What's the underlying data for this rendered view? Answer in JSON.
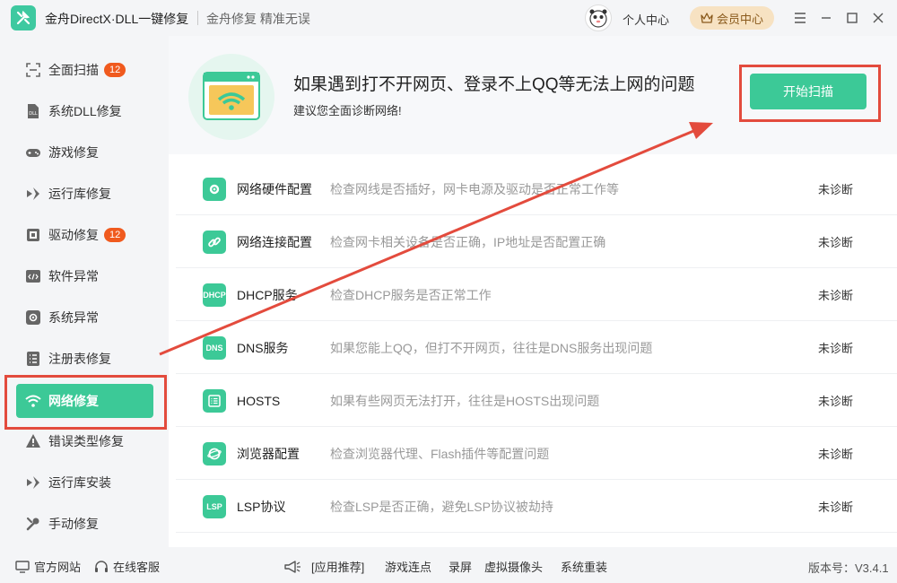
{
  "app": {
    "title": "金舟DirectX·DLL一键修复",
    "slogan": "金舟修复 精准无误",
    "personal_center": "个人中心",
    "vip_center": "会员中心"
  },
  "sidebar": {
    "items": [
      {
        "label": "全面扫描",
        "icon": "scan-icon",
        "badge": "12"
      },
      {
        "label": "系统DLL修复",
        "icon": "dll-icon"
      },
      {
        "label": "游戏修复",
        "icon": "gamepad-icon"
      },
      {
        "label": "运行库修复",
        "icon": "runtime-icon"
      },
      {
        "label": "驱动修复",
        "icon": "driver-icon",
        "badge": "12"
      },
      {
        "label": "软件异常",
        "icon": "code-icon"
      },
      {
        "label": "系统异常",
        "icon": "gear-icon"
      },
      {
        "label": "注册表修复",
        "icon": "registry-icon"
      },
      {
        "label": "网络修复",
        "icon": "wifi-icon",
        "active": true
      },
      {
        "label": "错误类型修复",
        "icon": "warning-icon"
      },
      {
        "label": "运行库安装",
        "icon": "runtime-install-icon"
      },
      {
        "label": "手动修复",
        "icon": "wrench-icon"
      }
    ]
  },
  "hero": {
    "title": "如果遇到打不开网页、登录不上QQ等无法上网的问题",
    "subtitle": "建议您全面诊断网络!",
    "scan_button": "开始扫描"
  },
  "checks": [
    {
      "name": "网络硬件配置",
      "desc": "检查网线是否插好，网卡电源及驱动是否正常工作等",
      "status": "未诊断",
      "icon": "gear-icon",
      "icon_text": ""
    },
    {
      "name": "网络连接配置",
      "desc": "检查网卡相关设备是否正确，IP地址是否配置正确",
      "status": "未诊断",
      "icon": "link-icon",
      "icon_text": ""
    },
    {
      "name": "DHCP服务",
      "desc": "检查DHCP服务是否正常工作",
      "status": "未诊断",
      "icon": "dhcp-icon",
      "icon_text": "DHCP"
    },
    {
      "name": "DNS服务",
      "desc": "如果您能上QQ，但打不开网页，往往是DNS服务出现问题",
      "status": "未诊断",
      "icon": "dns-icon",
      "icon_text": "DNS"
    },
    {
      "name": "HOSTS",
      "desc": "如果有些网页无法打开，往往是HOSTS出现问题",
      "status": "未诊断",
      "icon": "hosts-icon",
      "icon_text": ""
    },
    {
      "name": "浏览器配置",
      "desc": "检查浏览器代理、Flash插件等配置问题",
      "status": "未诊断",
      "icon": "browser-icon",
      "icon_text": ""
    },
    {
      "name": "LSP协议",
      "desc": "检查LSP是否正确，避免LSP协议被劫持",
      "status": "未诊断",
      "icon": "lsp-icon",
      "icon_text": "LSP"
    }
  ],
  "footer": {
    "official_site": "官方网站",
    "online_service": "在线客服",
    "recommend": "[应用推荐]",
    "links": [
      "游戏连点",
      "录屏",
      "虚拟摄像头",
      "系统重装"
    ],
    "version": "版本号：V3.4.1"
  },
  "colors": {
    "accent": "#3cc997",
    "badge": "#f05a1e",
    "annotation": "#e34b3d"
  }
}
